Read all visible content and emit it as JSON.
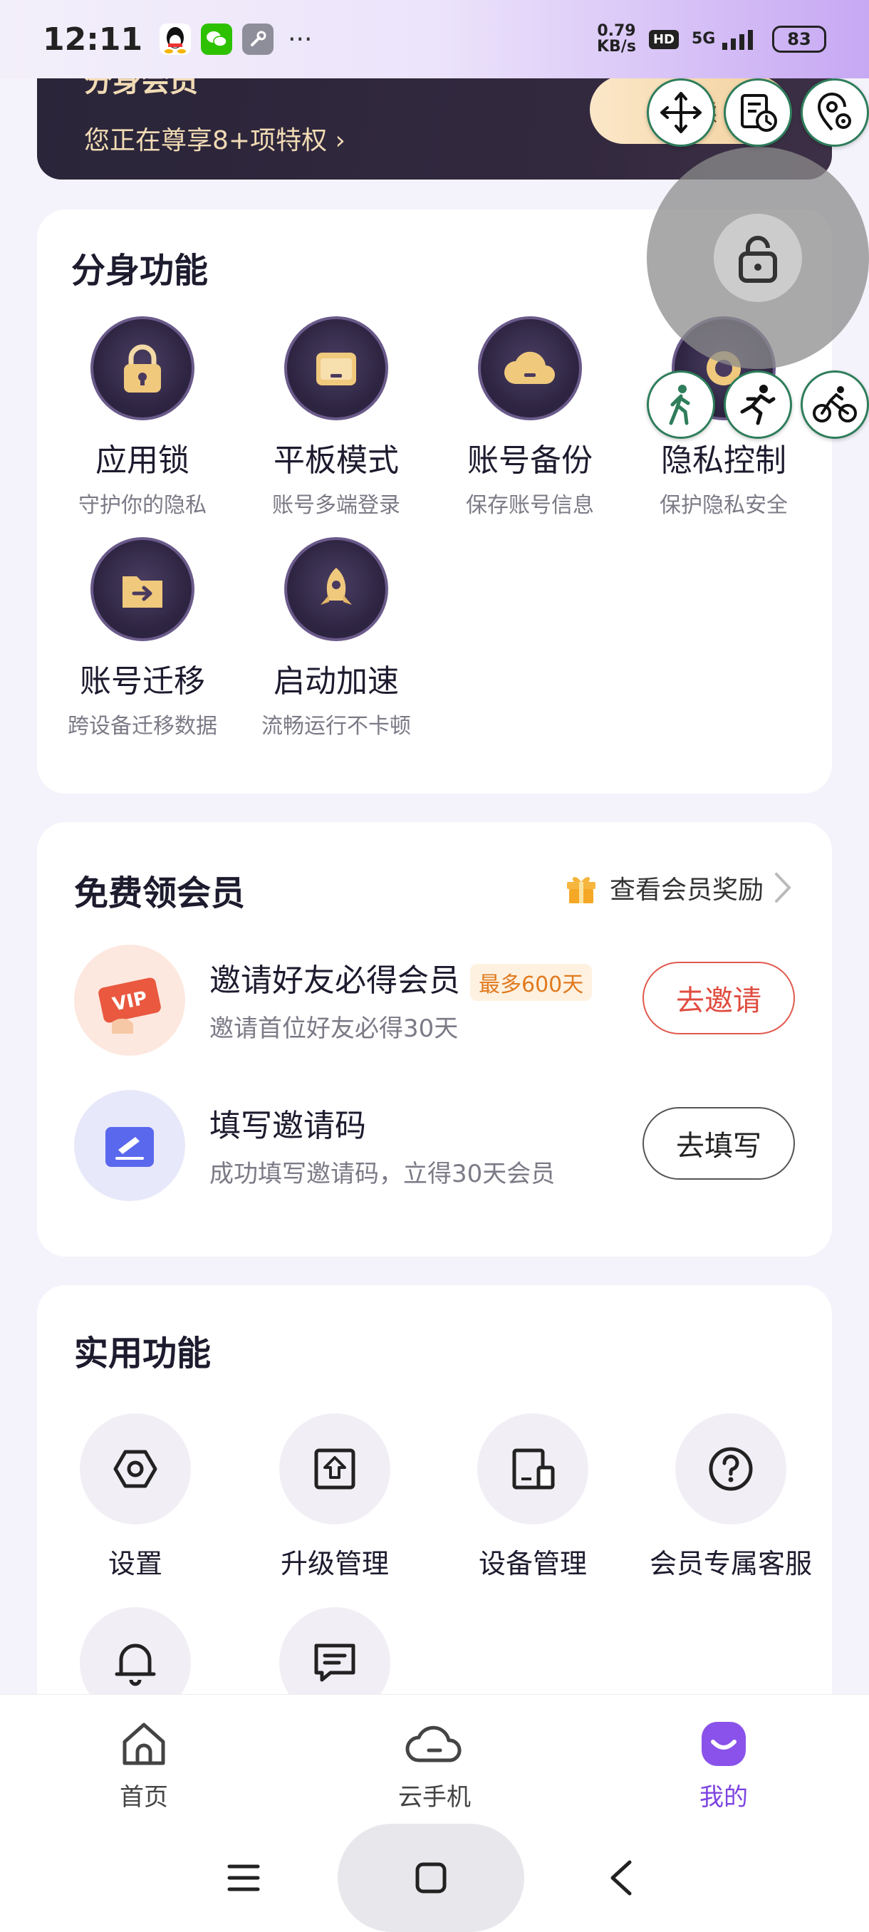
{
  "status_bar": {
    "time": "12:11",
    "dots": "···",
    "net_speed_value": "0.79",
    "net_speed_unit": "KB/s",
    "hd": "HD",
    "network": "5G",
    "battery": "83"
  },
  "vip_card": {
    "title": "分身会员",
    "subtitle": "您正在尊享8+项特权 ›",
    "pill": "开 续"
  },
  "clone_features": {
    "title": "分身功能",
    "items": [
      {
        "label": "应用锁",
        "desc": "守护你的隐私",
        "icon": "lock-icon"
      },
      {
        "label": "平板模式",
        "desc": "账号多端登录",
        "icon": "tablet-icon"
      },
      {
        "label": "账号备份",
        "desc": "保存账号信息",
        "icon": "cloud-icon"
      },
      {
        "label": "隐私控制",
        "desc": "保护隐私安全",
        "icon": "privacy-icon"
      },
      {
        "label": "账号迁移",
        "desc": "跨设备迁移数据",
        "icon": "folder-migrate-icon"
      },
      {
        "label": "启动加速",
        "desc": "流畅运行不卡顿",
        "icon": "rocket-icon"
      }
    ]
  },
  "free_vip": {
    "title": "免费领会员",
    "reward_link": "查看会员奖励",
    "invite": {
      "title": "邀请好友必得会员",
      "badge": "最多600天",
      "desc": "邀请首位好友必得30天",
      "button": "去邀请"
    },
    "code": {
      "title": "填写邀请码",
      "desc": "成功填写邀请码，立得30天会员",
      "button": "去填写"
    }
  },
  "utilities": {
    "title": "实用功能",
    "items": [
      {
        "label": "设置",
        "icon": "settings-hex-icon"
      },
      {
        "label": "升级管理",
        "icon": "upgrade-icon"
      },
      {
        "label": "设备管理",
        "icon": "device-icon"
      },
      {
        "label": "会员专属客服",
        "icon": "help-icon"
      }
    ]
  },
  "tabbar": {
    "items": [
      {
        "label": "首页",
        "icon": "home-icon"
      },
      {
        "label": "云手机",
        "icon": "cloud-phone-icon"
      },
      {
        "label": "我的",
        "icon": "profile-icon"
      }
    ],
    "active": "我的"
  },
  "colors": {
    "accent": "#7d44e0",
    "invite_red": "#e04c40",
    "gold": "#f1dbb4"
  }
}
